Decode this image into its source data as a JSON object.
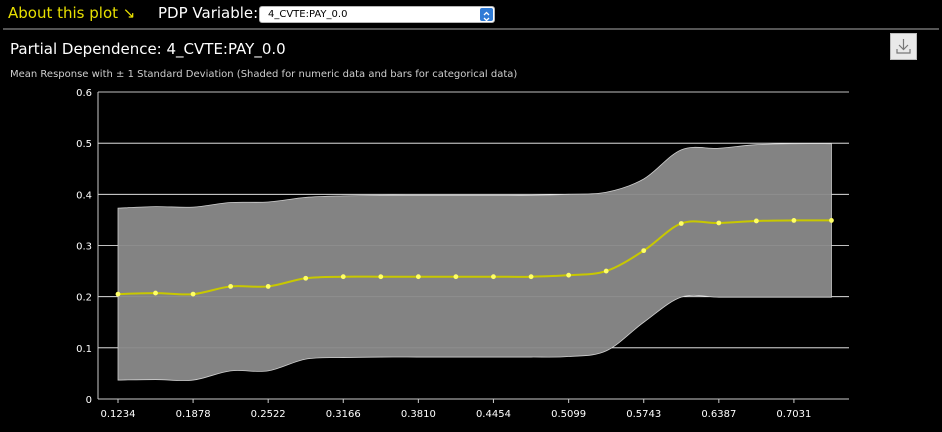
{
  "header": {
    "about_label": "About this plot ↘",
    "pdp_label": "PDP Variable:",
    "selected_variable": "4_CVTE:PAY_0.0"
  },
  "icons": {
    "download": "download-icon",
    "dropdown": "chevron-updown-icon"
  },
  "colors": {
    "accent": "#e8e000",
    "band": "#8a8a8a",
    "line": "#c8c800",
    "point": "#ffff66",
    "grid": "#ffffff"
  },
  "chart_data": {
    "type": "line",
    "title": "Partial Dependence: 4_CVTE:PAY_0.0",
    "subtitle": "Mean Response with ± 1 Standard Deviation (Shaded for numeric data and bars for categorical data)",
    "xlabel": "",
    "ylabel": "",
    "x_tick_labels": [
      "0.1234",
      "0.1878",
      "0.2522",
      "0.3166",
      "0.3810",
      "0.4454",
      "0.5099",
      "0.5743",
      "0.6387",
      "0.7031"
    ],
    "y_tick_labels": [
      "0",
      "0.1",
      "0.2",
      "0.3",
      "0.4",
      "0.5",
      "0.6"
    ],
    "ylim": [
      0,
      0.6
    ],
    "xlim": [
      0.1234,
      0.7675
    ],
    "grid": true,
    "series": [
      {
        "x": [
          0.1234,
          0.1556,
          0.1878,
          0.22,
          0.2522,
          0.2844,
          0.3166,
          0.3488,
          0.381,
          0.4132,
          0.4454,
          0.4777,
          0.5099,
          0.5421,
          0.5743,
          0.6065,
          0.6387,
          0.6709,
          0.7031,
          0.7353
        ],
        "mean": [
          0.205,
          0.207,
          0.205,
          0.22,
          0.22,
          0.236,
          0.239,
          0.239,
          0.239,
          0.239,
          0.239,
          0.239,
          0.242,
          0.25,
          0.29,
          0.343,
          0.344,
          0.348,
          0.349,
          0.349
        ],
        "upper": [
          0.373,
          0.376,
          0.375,
          0.384,
          0.385,
          0.394,
          0.397,
          0.398,
          0.398,
          0.398,
          0.398,
          0.398,
          0.4,
          0.404,
          0.43,
          0.487,
          0.49,
          0.497,
          0.499,
          0.499
        ],
        "lower": [
          0.037,
          0.038,
          0.037,
          0.055,
          0.055,
          0.078,
          0.081,
          0.082,
          0.082,
          0.082,
          0.082,
          0.082,
          0.083,
          0.094,
          0.15,
          0.199,
          0.199,
          0.199,
          0.199,
          0.199
        ]
      }
    ]
  }
}
